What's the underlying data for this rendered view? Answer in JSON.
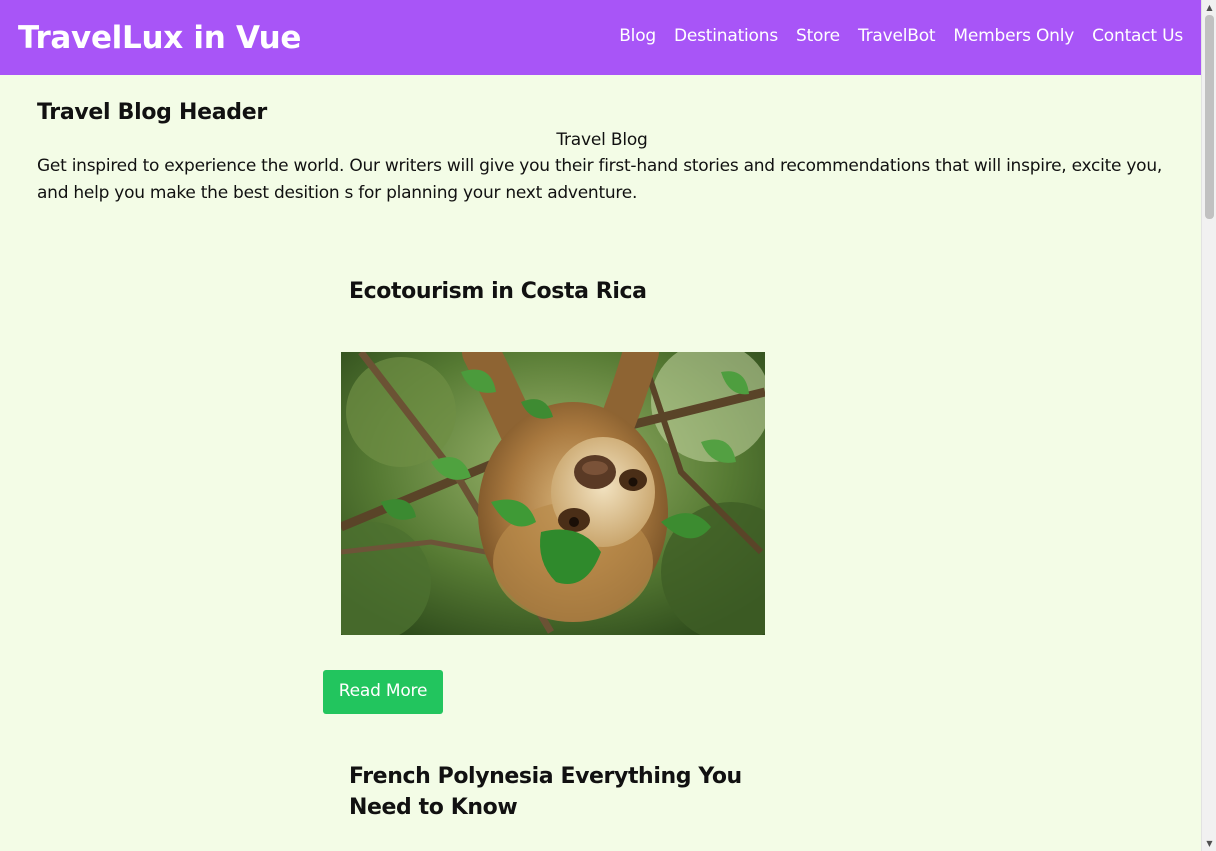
{
  "header": {
    "brand": "TravelLux in Vue",
    "nav": [
      "Blog",
      "Destinations",
      "Store",
      "TravelBot",
      "Members Only",
      "Contact Us"
    ],
    "bg_color": "#a855f7"
  },
  "intro": {
    "heading": "Travel Blog Header",
    "subtitle": "Travel Blog",
    "description": "Get inspired to experience the world. Our writers will give you their first-hand stories and recommendations that will inspire, excite you, and help you make the best desition s for planning your next adventure."
  },
  "posts": [
    {
      "title": "Ecotourism in Costa Rica",
      "image": "sloth-in-tree",
      "button": "Read More"
    },
    {
      "title": "French Polynesia Everything You Need to Know"
    }
  ],
  "colors": {
    "page_bg": "#f3fce6",
    "button_bg": "#22c55e"
  },
  "scrollbar": {
    "up_icon": "▲",
    "down_icon": "▼"
  }
}
